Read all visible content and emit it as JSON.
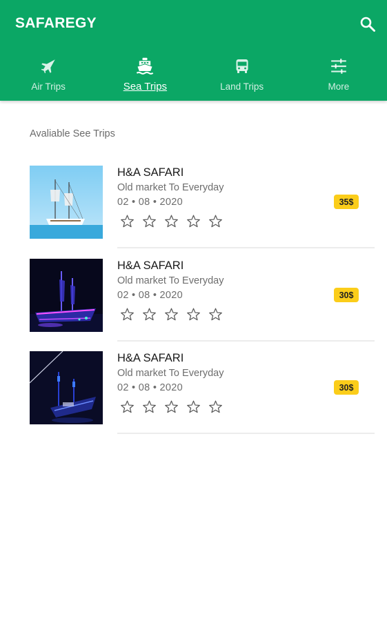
{
  "app": {
    "title": "SAFAREGY"
  },
  "header": {
    "search_icon": "search-icon"
  },
  "tabs": [
    {
      "label": "Air Trips",
      "icon": "airplane-icon",
      "active": false
    },
    {
      "label": "Sea Trips",
      "icon": "ship-icon",
      "active": true
    },
    {
      "label": "Land Trips",
      "icon": "bus-icon",
      "active": false
    },
    {
      "label": "More",
      "icon": "sliders-icon",
      "active": false
    }
  ],
  "section": {
    "title": "Avaliable See Trips"
  },
  "trips": [
    {
      "name": "H&A SAFARI",
      "route": "Old market To Everyday",
      "date": "02 • 08 • 2020",
      "price": "35$",
      "rating": 0,
      "rating_max": 5,
      "image": "sailing-ship-day-photo"
    },
    {
      "name": "H&A SAFARI",
      "route": "Old market To Everyday",
      "date": "02 • 08 • 2020",
      "price": "30$",
      "rating": 0,
      "rating_max": 5,
      "image": "sailing-ship-night-photo"
    },
    {
      "name": "H&A SAFARI",
      "route": "Old market To Everyday",
      "date": "02 • 08 • 2020",
      "price": "30$",
      "rating": 0,
      "rating_max": 5,
      "image": "ship-night-blue-photo"
    }
  ],
  "colors": {
    "primary": "#0ba765",
    "price_badge": "#fbcd1a",
    "text_secondary": "#6d6d6d"
  }
}
